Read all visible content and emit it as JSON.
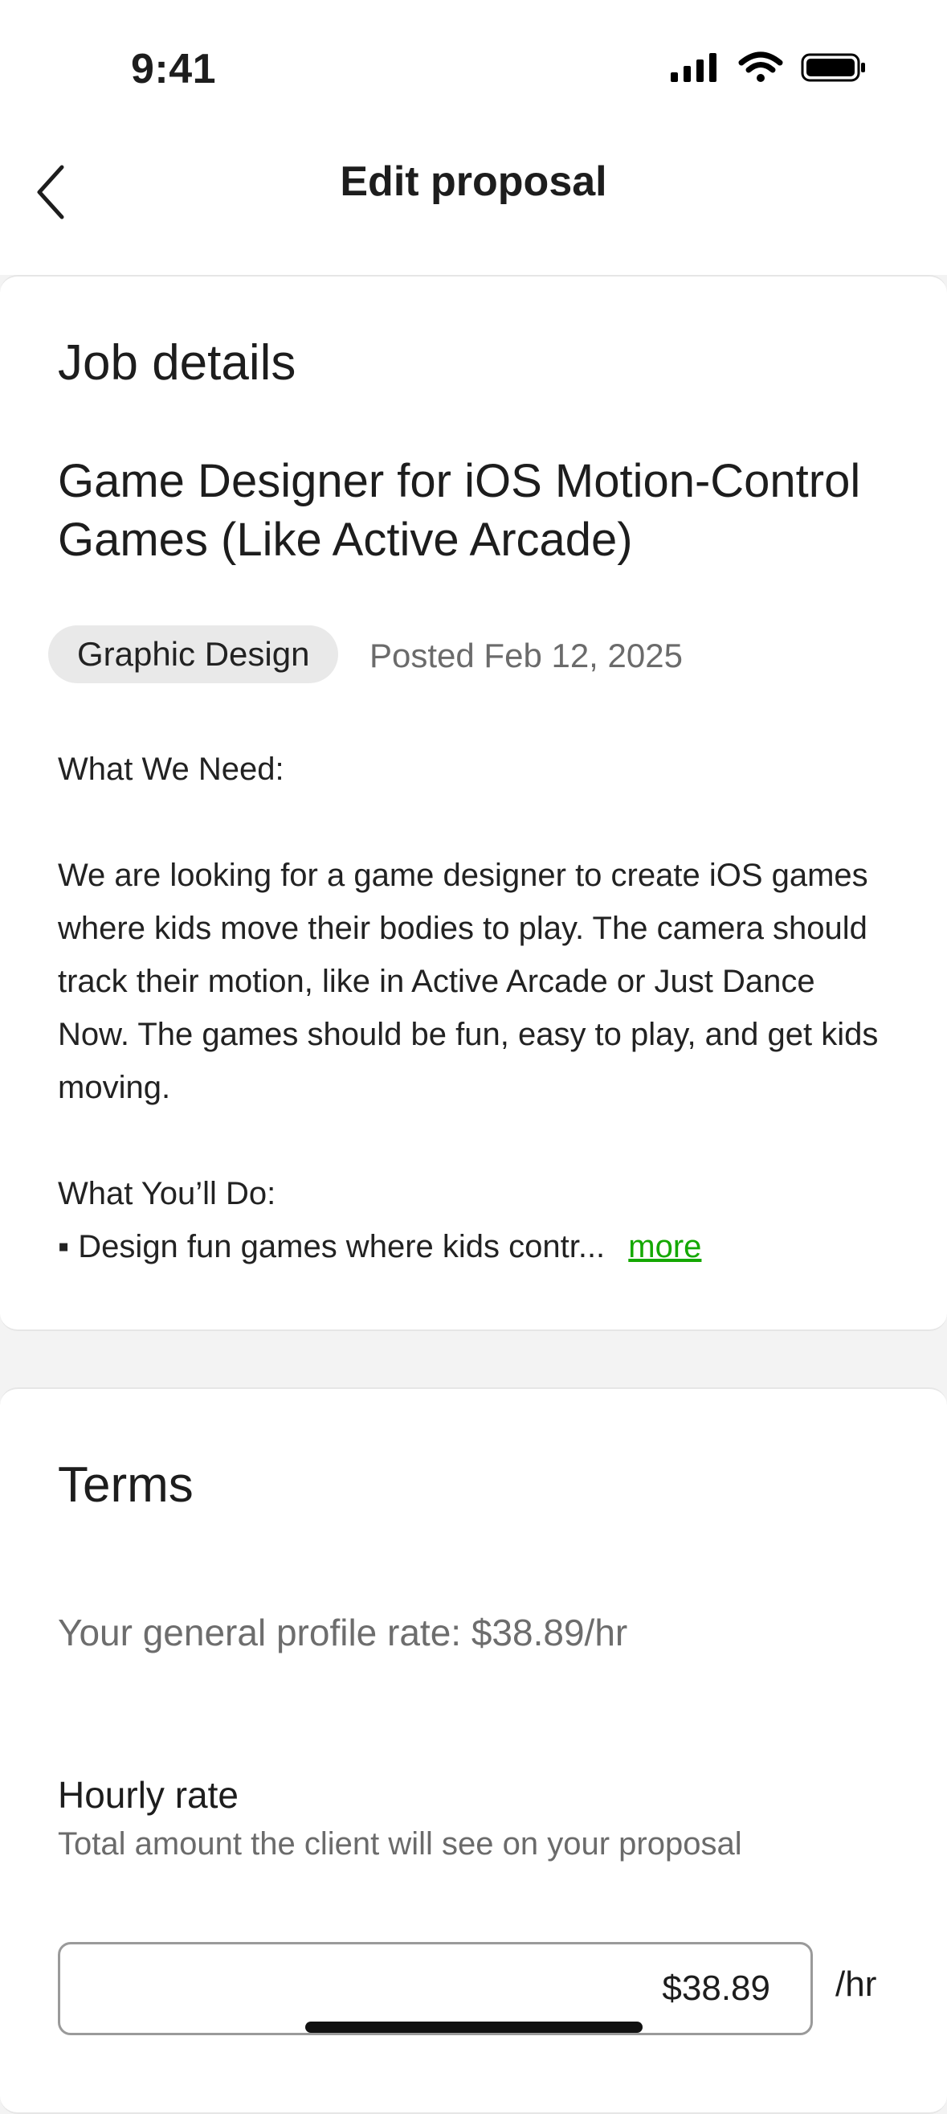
{
  "status_bar": {
    "time": "9:41",
    "icons": [
      "signal-icon",
      "wifi-icon",
      "battery-icon"
    ]
  },
  "nav": {
    "title": "Edit proposal",
    "back_icon": "chevron-left-icon"
  },
  "job_details": {
    "heading": "Job details",
    "job_title": "Game Designer for iOS Motion-Control Games (Like Active Arcade)",
    "category": "Graphic Design",
    "posted": "Posted Feb 12, 2025",
    "need_heading": "What We Need:",
    "need_text": "We are looking for a game designer to create iOS games where kids move their bodies to play. The camera should track their motion, like in Active Arcade or Just Dance Now. The games should be fun, easy to play, and get kids moving.",
    "do_heading": "What You’ll Do:",
    "do_first_item": "▪ Design fun games where kids contr...",
    "more_label": "more"
  },
  "terms": {
    "heading": "Terms",
    "profile_rate": "Your general profile rate: $38.89/hr",
    "hourly_label": "Hourly rate",
    "hourly_hint": "Total amount the client will see on your proposal",
    "hourly_value": "$38.89",
    "unit": "/hr"
  },
  "colors": {
    "accent": "#14a800",
    "background": "#f3f3f3",
    "card": "#ffffff"
  }
}
